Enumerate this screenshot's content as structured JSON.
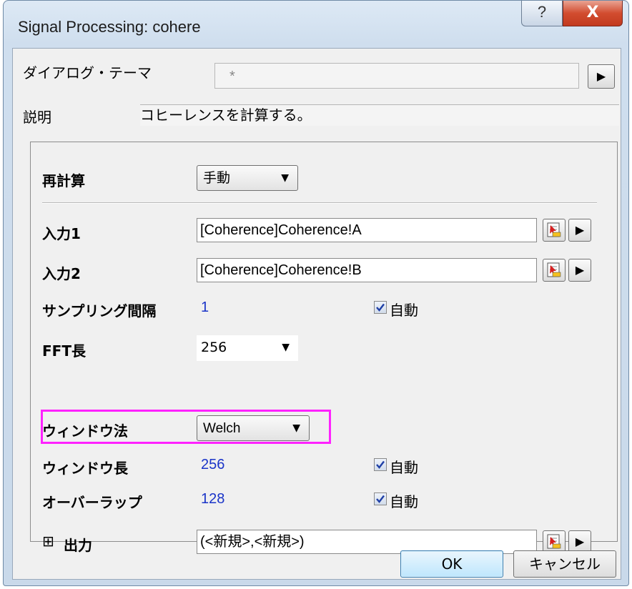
{
  "window": {
    "title": "Signal Processing: cohere",
    "help_label": "?",
    "close_label": "X"
  },
  "dialog_theme": {
    "label": "ダイアログ・テーマ",
    "value": "*"
  },
  "description": {
    "label": "説明",
    "value": "コヒーレンスを計算する。"
  },
  "recalc": {
    "label": "再計算",
    "value": "手動"
  },
  "input1": {
    "label": "入力1",
    "value": "[Coherence]Coherence!A"
  },
  "input2": {
    "label": "入力2",
    "value": "[Coherence]Coherence!B"
  },
  "sampling": {
    "label": "サンプリング間隔",
    "value": "1",
    "auto_label": "自動",
    "auto_checked": true
  },
  "fft": {
    "label": "FFT長",
    "value": "256"
  },
  "window_method": {
    "label": "ウィンドウ法",
    "value": "Welch",
    "highlight_color": "#ff22ff"
  },
  "window_length": {
    "label": "ウィンドウ長",
    "value": "256",
    "auto_label": "自動",
    "auto_checked": true
  },
  "overlap": {
    "label": "オーバーラップ",
    "value": "128",
    "auto_label": "自動",
    "auto_checked": true
  },
  "output": {
    "expander": "⊞",
    "label": "出力",
    "value": "(<新規>,<新規>)"
  },
  "buttons": {
    "ok": "OK",
    "cancel": "キャンセル"
  },
  "colors": {
    "value_text": "#1a34c8",
    "close_button": "#c23a1f"
  },
  "icons": {
    "arrow": "play-arrow-icon",
    "picker": "range-picker-icon",
    "check": "check-icon"
  }
}
